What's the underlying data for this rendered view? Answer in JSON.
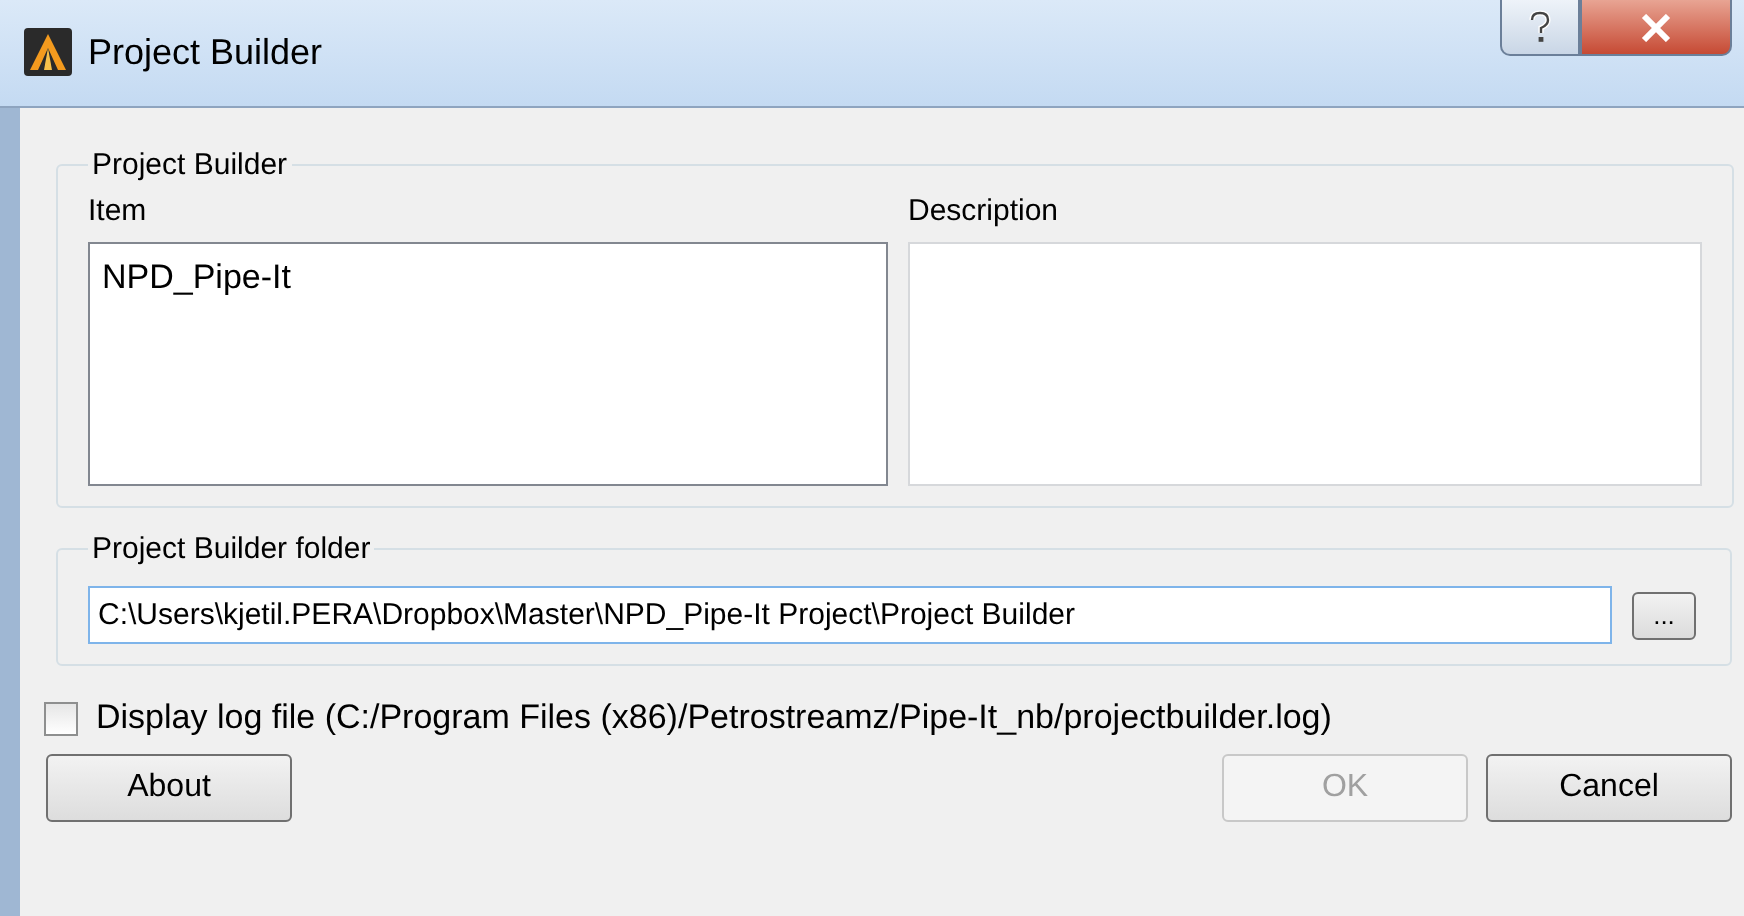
{
  "window": {
    "title": "Project Builder"
  },
  "builder_group": {
    "title": "Project Builder",
    "item_label": "Item",
    "description_label": "Description",
    "items": [
      {
        "label": "NPD_Pipe-It",
        "selected": false
      }
    ]
  },
  "folder_group": {
    "title": "Project Builder folder",
    "value": "C:\\Users\\kjetil.PERA\\Dropbox\\Master\\NPD_Pipe-It Project\\Project Builder",
    "browse_label": "..."
  },
  "log_option": {
    "label": "Display log file (C:/Program Files (x86)/Petrostreamz/Pipe-It_nb/projectbuilder.log)",
    "checked": false
  },
  "left_buttons": [
    {
      "label": "About",
      "disabled": false
    }
  ],
  "right_buttons": [
    {
      "label": "OK",
      "disabled": true
    },
    {
      "label": "Cancel",
      "disabled": false
    }
  ]
}
